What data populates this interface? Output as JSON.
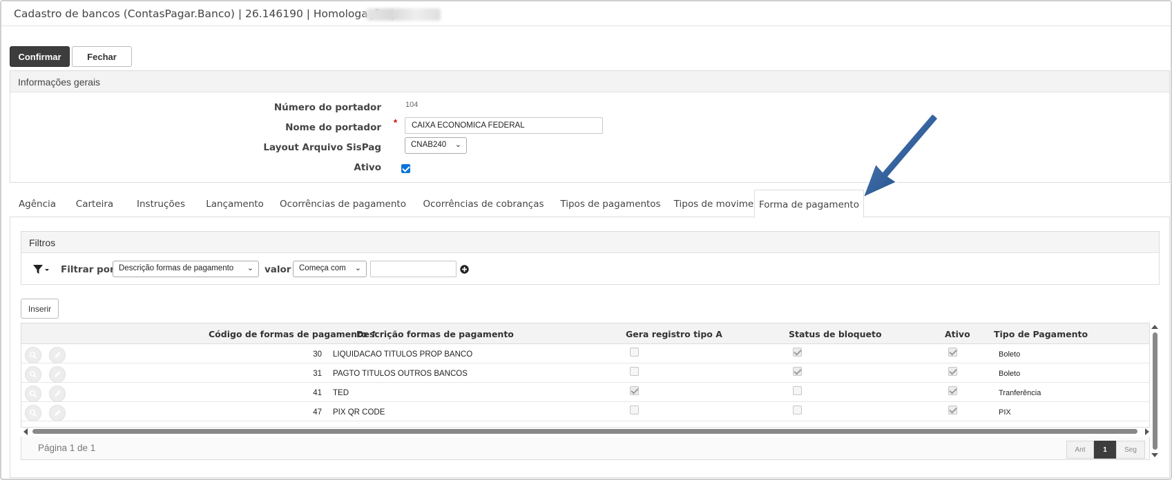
{
  "window": {
    "title": "Cadastro de bancos (ContasPagar.Banco) | 26.146190 | Homologação |"
  },
  "toolbar": {
    "confirm_label": "Confirmar",
    "close_label": "Fechar"
  },
  "general_info": {
    "header": "Informações gerais",
    "numero_label": "Número do portador",
    "numero_value": "104",
    "nome_label": "Nome do portador",
    "nome_value": "CAIXA ECONOMICA FEDERAL",
    "required_mark": "*",
    "layout_label": "Layout Arquivo SisPag",
    "layout_value": "CNAB240",
    "ativo_label": "Ativo",
    "ativo_checked": true
  },
  "tabs": [
    {
      "label": "Agência"
    },
    {
      "label": "Carteira"
    },
    {
      "label": "Instruções"
    },
    {
      "label": "Lançamento"
    },
    {
      "label": "Ocorrências de pagamento"
    },
    {
      "label": "Ocorrências de cobranças"
    },
    {
      "label": "Tipos de pagamentos"
    },
    {
      "label": "Tipos de movimentos"
    },
    {
      "label": "Forma de pagamento",
      "active": true
    }
  ],
  "filters": {
    "header": "Filtros",
    "filter_by_label": "Filtrar por",
    "field_value": "Descrição formas de pagamento",
    "valor_label": "valor",
    "operator_value": "Começa com",
    "search_value": ""
  },
  "insert_label": "Inserir",
  "grid": {
    "columns": {
      "codigo": "Código de formas de pagamento",
      "descricao": "Descrição formas de pagamento",
      "gera": "Gera registro tipo A",
      "status": "Status de bloqueto",
      "ativo": "Ativo",
      "tipo": "Tipo de Pagamento"
    },
    "sort_indicator": "↑",
    "rows": [
      {
        "codigo": "30",
        "descricao": "LIQUIDACAO TITULOS PROP BANCO",
        "gera": false,
        "status": true,
        "ativo": true,
        "tipo": "Boleto"
      },
      {
        "codigo": "31",
        "descricao": "PAGTO TITULOS OUTROS BANCOS",
        "gera": false,
        "status": true,
        "ativo": true,
        "tipo": "Boleto"
      },
      {
        "codigo": "41",
        "descricao": "TED",
        "gera": true,
        "status": false,
        "ativo": true,
        "tipo": "Tranferência"
      },
      {
        "codigo": "47",
        "descricao": "PIX QR CODE",
        "gera": false,
        "status": false,
        "ativo": true,
        "tipo": "PIX"
      }
    ]
  },
  "pager": {
    "page_info": "Página 1 de 1",
    "prev_label": "Ant",
    "current_page": "1",
    "next_label": "Seg"
  },
  "colors": {
    "primary_button": "#3d3d3d",
    "checkbox_accent": "#0a74db",
    "annotation_arrow": "#1f4f8a"
  }
}
